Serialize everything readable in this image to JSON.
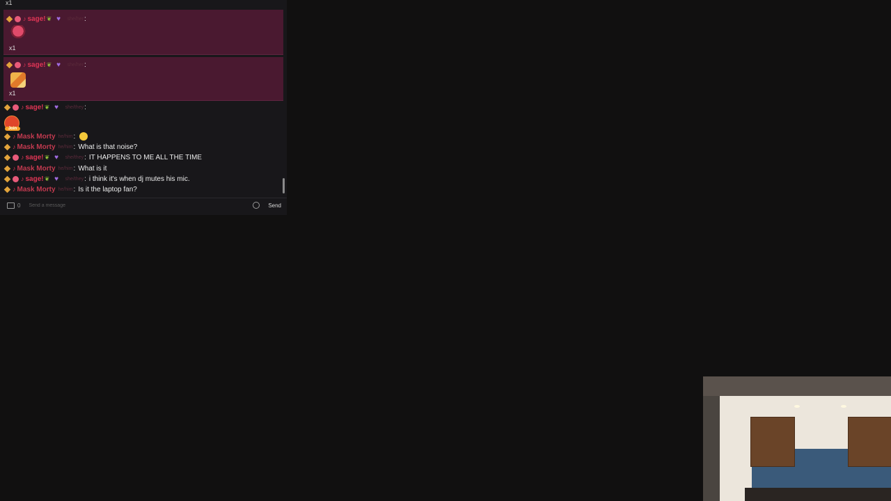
{
  "chat": {
    "top_clip": "x1",
    "gifts": [
      {
        "username": "sage!",
        "pronoun": "she/her",
        "count": "x1",
        "gift": "rose-gift-icon"
      },
      {
        "username": "sage!",
        "pronoun": "she/her",
        "count": "x1",
        "gift": "arrow-gift-icon"
      }
    ],
    "join": {
      "username": "sage!",
      "pronoun": "she/they",
      "label": "Join"
    },
    "messages": [
      {
        "username": "Mask Morty",
        "pronoun": "he/him",
        "text": ""
      },
      {
        "username": "Mask Morty",
        "pronoun": "he/him",
        "text": "What is that noise?"
      },
      {
        "username": "sage!",
        "pronoun": "she/they",
        "text": "IT HAPPENS TO ME ALL THE TIME"
      },
      {
        "username": "Mask Morty",
        "pronoun": "he/him",
        "text": "What is it"
      },
      {
        "username": "sage!",
        "pronoun": "she/they",
        "text": "i think it's when dj mutes his mic."
      },
      {
        "username": "Mask Morty",
        "pronoun": "he/him",
        "text": "Is it the laptop fan?"
      }
    ],
    "input": {
      "placeholder": "Send a message",
      "count": "0",
      "send_label": "Send"
    }
  },
  "colors": {
    "gift_row_bg": "#4a1930",
    "username": "#e03555",
    "background": "#111010"
  }
}
